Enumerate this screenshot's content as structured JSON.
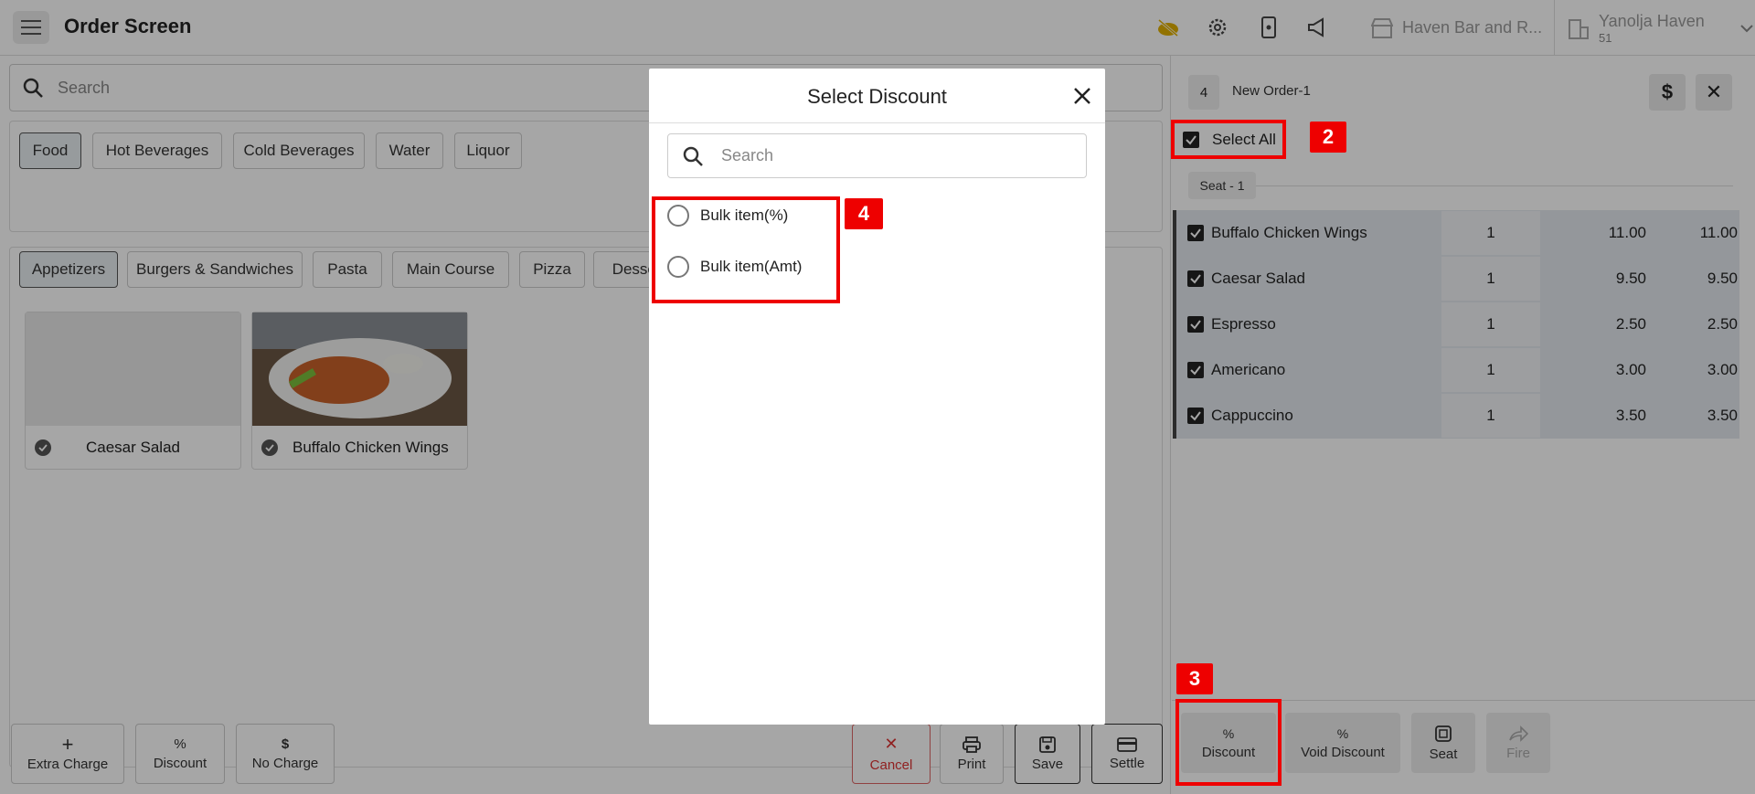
{
  "topbar": {
    "title": "Order Screen",
    "venue": "Haven Bar and R...",
    "user_name": "Yanolja Haven",
    "user_sub": "51"
  },
  "left": {
    "search_placeholder": "Search",
    "categories": [
      "Food",
      "Hot Beverages",
      "Cold Beverages",
      "Water",
      "Liquor"
    ],
    "subcategories": [
      "Appetizers",
      "Burgers & Sandwiches",
      "Pasta",
      "Main Course",
      "Pizza",
      "Dessert"
    ],
    "products": [
      "Caesar Salad",
      "Buffalo Chicken Wings"
    ],
    "bottom_buttons": [
      "Extra Charge",
      "Discount",
      "No Charge"
    ],
    "action_buttons": [
      "Cancel",
      "Print",
      "Save",
      "Settle"
    ]
  },
  "right": {
    "order_number": "4",
    "order_name": "New Order-1",
    "select_all": "Select All",
    "seat_label": "Seat - 1",
    "items": [
      {
        "name": "Buffalo Chicken Wings",
        "qty": "1",
        "price": "11.00",
        "total": "11.00"
      },
      {
        "name": "Caesar Salad",
        "qty": "1",
        "price": "9.50",
        "total": "9.50"
      },
      {
        "name": "Espresso",
        "qty": "1",
        "price": "2.50",
        "total": "2.50"
      },
      {
        "name": "Americano",
        "qty": "1",
        "price": "3.00",
        "total": "3.00"
      },
      {
        "name": "Cappuccino",
        "qty": "1",
        "price": "3.50",
        "total": "3.50"
      }
    ],
    "actions": [
      "Discount",
      "Void Discount",
      "Seat",
      "Fire"
    ]
  },
  "modal": {
    "title": "Select Discount",
    "search_placeholder": "Search",
    "options": [
      "Bulk item(%)",
      "Bulk item(Amt)"
    ]
  },
  "annotations": [
    "2",
    "3",
    "4"
  ],
  "colors": {
    "accent_red": "#e00000",
    "selected_row": "#e4e9ef",
    "overlay": "#000000"
  }
}
